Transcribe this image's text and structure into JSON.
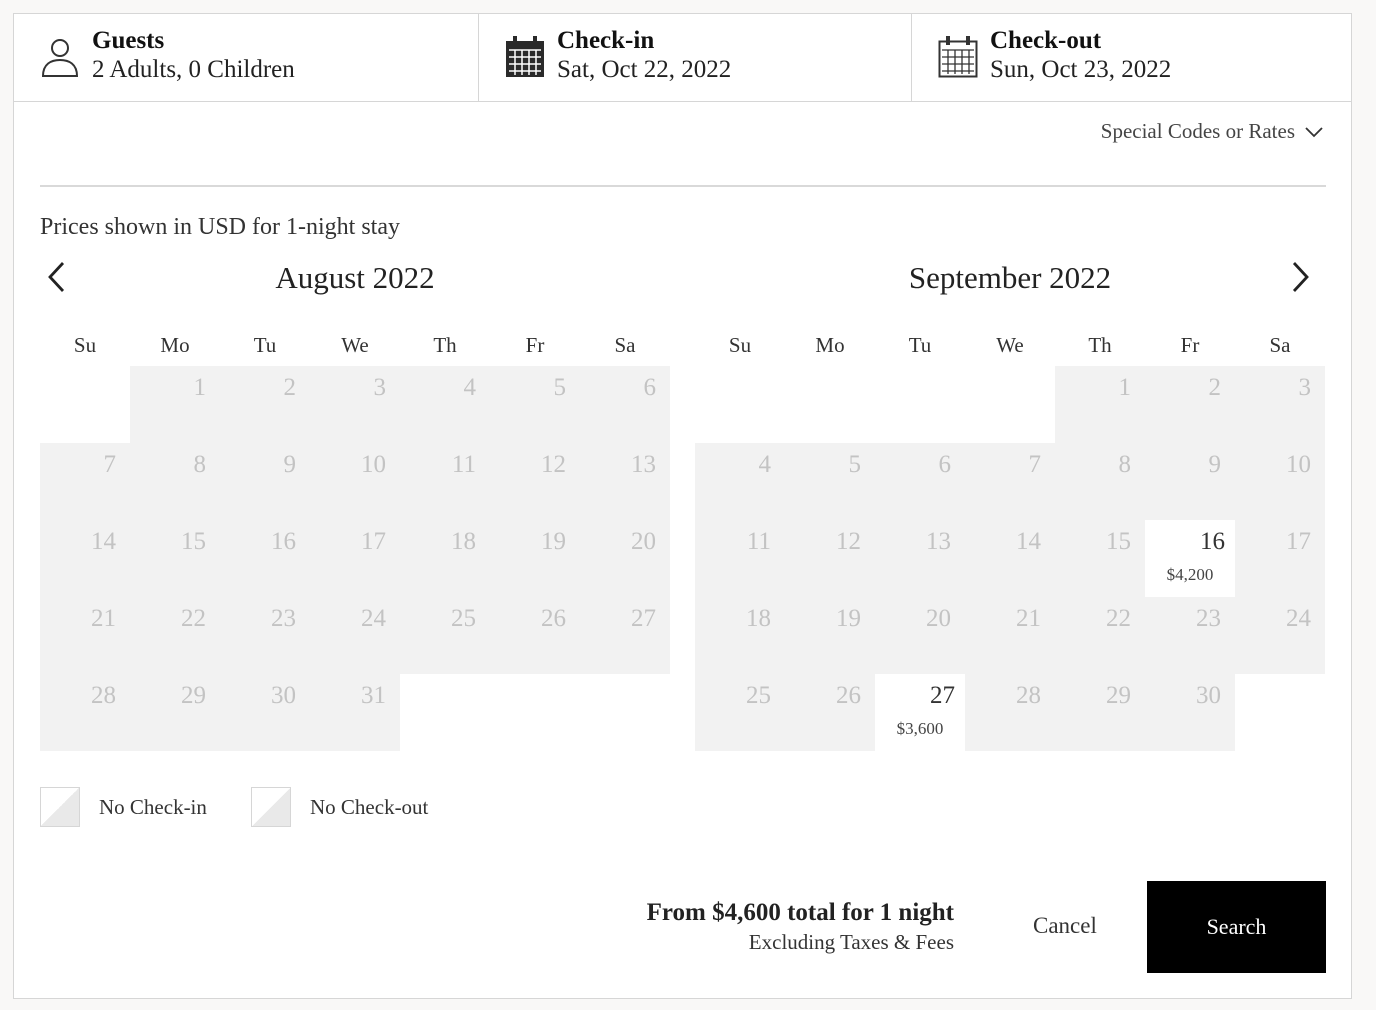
{
  "header": {
    "guests": {
      "label": "Guests",
      "value": "2 Adults, 0 Children",
      "icon": "person-icon"
    },
    "checkin": {
      "label": "Check-in",
      "value": "Sat, Oct 22, 2022",
      "icon": "calendar-icon"
    },
    "checkout": {
      "label": "Check-out",
      "value": "Sun, Oct 23, 2022",
      "icon": "calendar-icon"
    }
  },
  "special_codes": {
    "label": "Special Codes or Rates"
  },
  "note": "Prices shown in USD for 1-night stay",
  "weekdays": [
    "Su",
    "Mo",
    "Tu",
    "We",
    "Th",
    "Fr",
    "Sa"
  ],
  "months": [
    {
      "title": "August 2022",
      "lead_blanks": 1,
      "days": [
        "1",
        "2",
        "3",
        "4",
        "5",
        "6",
        "7",
        "8",
        "9",
        "10",
        "11",
        "12",
        "13",
        "14",
        "15",
        "16",
        "17",
        "18",
        "19",
        "20",
        "21",
        "22",
        "23",
        "24",
        "25",
        "26",
        "27",
        "28",
        "29",
        "30",
        "31"
      ],
      "available": {}
    },
    {
      "title": "September 2022",
      "lead_blanks": 4,
      "days": [
        "1",
        "2",
        "3",
        "4",
        "5",
        "6",
        "7",
        "8",
        "9",
        "10",
        "11",
        "12",
        "13",
        "14",
        "15",
        "16",
        "17",
        "18",
        "19",
        "20",
        "21",
        "22",
        "23",
        "24",
        "25",
        "26",
        "27",
        "28",
        "29",
        "30"
      ],
      "available": {
        "16": "$4,200",
        "27": "$3,600"
      }
    }
  ],
  "legend": {
    "no_checkin": "No Check-in",
    "no_checkout": "No Check-out"
  },
  "summary": {
    "total": "From $4,600 total for 1 night",
    "sub": "Excluding Taxes & Fees"
  },
  "actions": {
    "cancel": "Cancel",
    "search": "Search"
  },
  "colors": {
    "accent": "#000000",
    "disabled_cell": "#f2f2f2",
    "disabled_text": "#c3c3c3"
  }
}
